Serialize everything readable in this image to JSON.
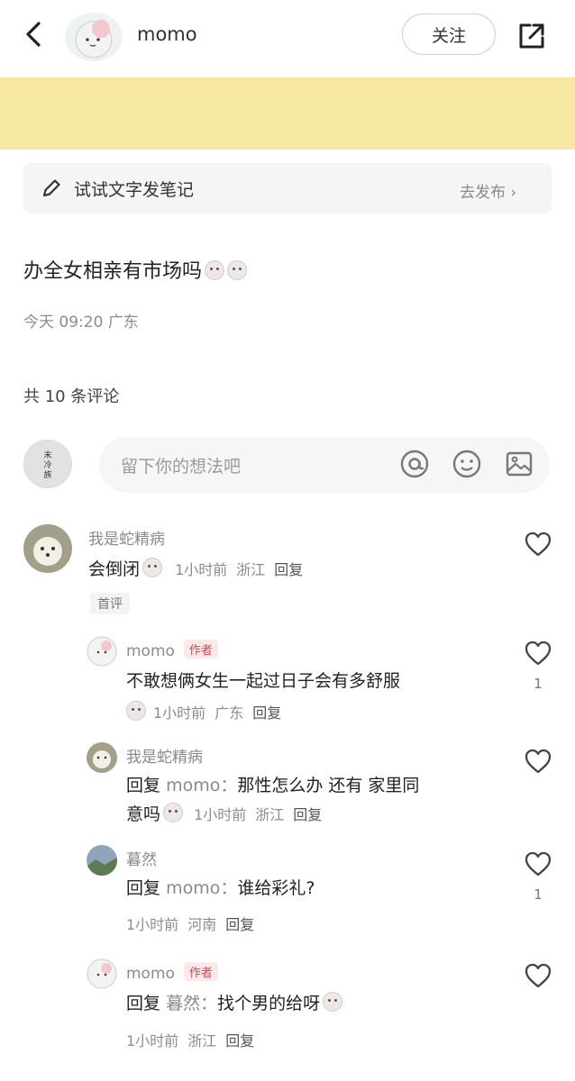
{
  "header": {
    "username": "momo",
    "follow_label": "关注"
  },
  "draft": {
    "label": "试试文字发笔记",
    "link": "去发布 ›"
  },
  "post": {
    "title": "办全女相亲有市场吗",
    "time": "今天 09:20",
    "location": "广东"
  },
  "comments_header": {
    "count_label": "共 10 条评论"
  },
  "input": {
    "placeholder": "留下你的想法吧"
  },
  "comments": [
    {
      "name": "我是蛇精病",
      "text": "会倒闭",
      "time": "1小时前",
      "location": "浙江",
      "reply": "回复",
      "badge": "首评"
    }
  ],
  "replies": [
    {
      "name": "momo",
      "tag": "作者",
      "text": "不敢想俩女生一起过日子会有多舒服",
      "time": "1小时前",
      "location": "广东",
      "reply": "回复",
      "likes": "1"
    },
    {
      "name": "我是蛇精病",
      "prefix": "回复",
      "target": "momo：",
      "text": "那性怎么办 还有 家里同",
      "text2": "意吗",
      "time": "1小时前",
      "location": "浙江",
      "reply": "回复"
    },
    {
      "name": "暮然",
      "prefix": "回复",
      "target": "momo：",
      "text": "谁给彩礼?",
      "time": "1小时前",
      "location": "河南",
      "reply": "回复",
      "likes": "1"
    },
    {
      "name": "momo",
      "tag": "作者",
      "prefix": "回复",
      "target": "暮然：",
      "text": "找个男的给呀",
      "time": "1小时前",
      "location": "浙江",
      "reply": "回复"
    }
  ],
  "icons": {
    "back": "chevron-left-icon",
    "share": "share-icon",
    "pen": "pen-icon",
    "at": "at-icon",
    "emoji": "smiley-icon",
    "image": "image-icon",
    "like": "heart-icon"
  },
  "colors": {
    "banner": "#f6e7a3",
    "author_tag": "#d3485b"
  }
}
